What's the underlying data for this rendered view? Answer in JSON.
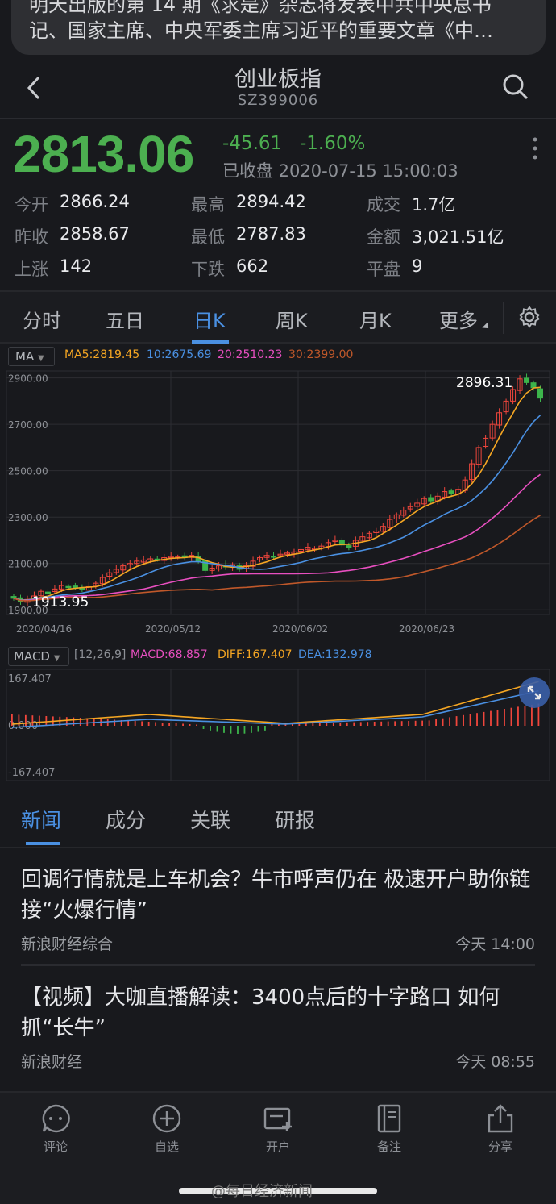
{
  "banner": {
    "line1": "明天出版的第 14 期《求是》杂志将发表中共中央总书",
    "line2": "记、国家主席、中央军委主席习近平的重要文章《中…"
  },
  "header": {
    "title": "创业板指",
    "code": "SZ399006"
  },
  "quote": {
    "price": "2813.06",
    "change": "-45.61",
    "change_pct": "-1.60%",
    "status": "已收盘 2020-07-15 15:00:03",
    "color": "#4caf50"
  },
  "stats": [
    {
      "label": "今开",
      "value": "2866.24"
    },
    {
      "label": "最高",
      "value": "2894.42"
    },
    {
      "label": "成交",
      "value": "1.7亿"
    },
    {
      "label": "昨收",
      "value": "2858.67"
    },
    {
      "label": "最低",
      "value": "2787.83"
    },
    {
      "label": "金额",
      "value": "3,021.51亿"
    },
    {
      "label": "上涨",
      "value": "142"
    },
    {
      "label": "下跌",
      "value": "662"
    },
    {
      "label": "平盘",
      "value": "9"
    }
  ],
  "tabs": [
    "分时",
    "五日",
    "日K",
    "周K",
    "月K",
    "更多"
  ],
  "active_tab": "日K",
  "kline": {
    "indicator": "MA",
    "ma5": "MA5:2819.45",
    "ma10": "10:2675.69",
    "ma20": "20:2510.23",
    "ma30": "30:2399.00",
    "y_ticks": [
      "2900.00",
      "2700.00",
      "2500.00",
      "2300.00",
      "2100.00",
      "1900.00"
    ],
    "x_ticks": [
      "2020/04/16",
      "2020/05/12",
      "2020/06/02",
      "2020/06/23"
    ],
    "high_label": "2896.31",
    "low_label": "1913.95",
    "colors": {
      "up": "#f0463c",
      "down": "#3cb44b",
      "ma5": "#f5a623",
      "ma10": "#4a90e2",
      "ma20": "#e84fc0",
      "ma30": "#c0582a"
    }
  },
  "macd": {
    "indicator": "MACD",
    "params": "[12,26,9]",
    "macd": "MACD:68.857",
    "diff": "DIFF:167.407",
    "dea": "DEA:132.978",
    "y_ticks": [
      "167.407",
      "0.000",
      "-167.407"
    ]
  },
  "chart_data": {
    "type": "candlestick",
    "title": "创业板指",
    "x_start": "2020/04/16",
    "x_end": "2020/07/15",
    "ylim": [
      1880,
      2930
    ],
    "close": [
      1950,
      1935,
      1945,
      1960,
      1980,
      1975,
      1990,
      2005,
      2000,
      1995,
      1990,
      2000,
      2015,
      2040,
      2060,
      2075,
      2090,
      2100,
      2110,
      2115,
      2120,
      2118,
      2125,
      2130,
      2128,
      2125,
      2135,
      2110,
      2070,
      2080,
      2090,
      2085,
      2095,
      2075,
      2090,
      2110,
      2125,
      2135,
      2130,
      2140,
      2145,
      2150,
      2160,
      2170,
      2165,
      2175,
      2190,
      2200,
      2180,
      2170,
      2200,
      2215,
      2230,
      2240,
      2260,
      2290,
      2310,
      2330,
      2345,
      2360,
      2380,
      2370,
      2390,
      2410,
      2400,
      2420,
      2460,
      2530,
      2600,
      2640,
      2700,
      2750,
      2800,
      2850,
      2896,
      2880,
      2858,
      2813
    ],
    "series": [
      {
        "name": "MA5",
        "value": 2819.45
      },
      {
        "name": "MA10",
        "value": 2675.69
      },
      {
        "name": "MA20",
        "value": 2510.23
      },
      {
        "name": "MA30",
        "value": 2399.0
      }
    ]
  },
  "news_tabs": [
    "新闻",
    "成分",
    "关联",
    "研报"
  ],
  "news": [
    {
      "title": "回调行情就是上车机会？牛市呼声仍在 极速开户助你链接“火爆行情”",
      "source": "新浪财经综合",
      "time": "今天 14:00"
    },
    {
      "title": "【视频】大咖直播解读：3400点后的十字路口 如何抓“长牛”",
      "source": "新浪财经",
      "time": "今天 08:55"
    }
  ],
  "bottom_bar": [
    "评论",
    "自选",
    "开户",
    "备注",
    "分享"
  ],
  "watermark": "@每日经济新闻"
}
